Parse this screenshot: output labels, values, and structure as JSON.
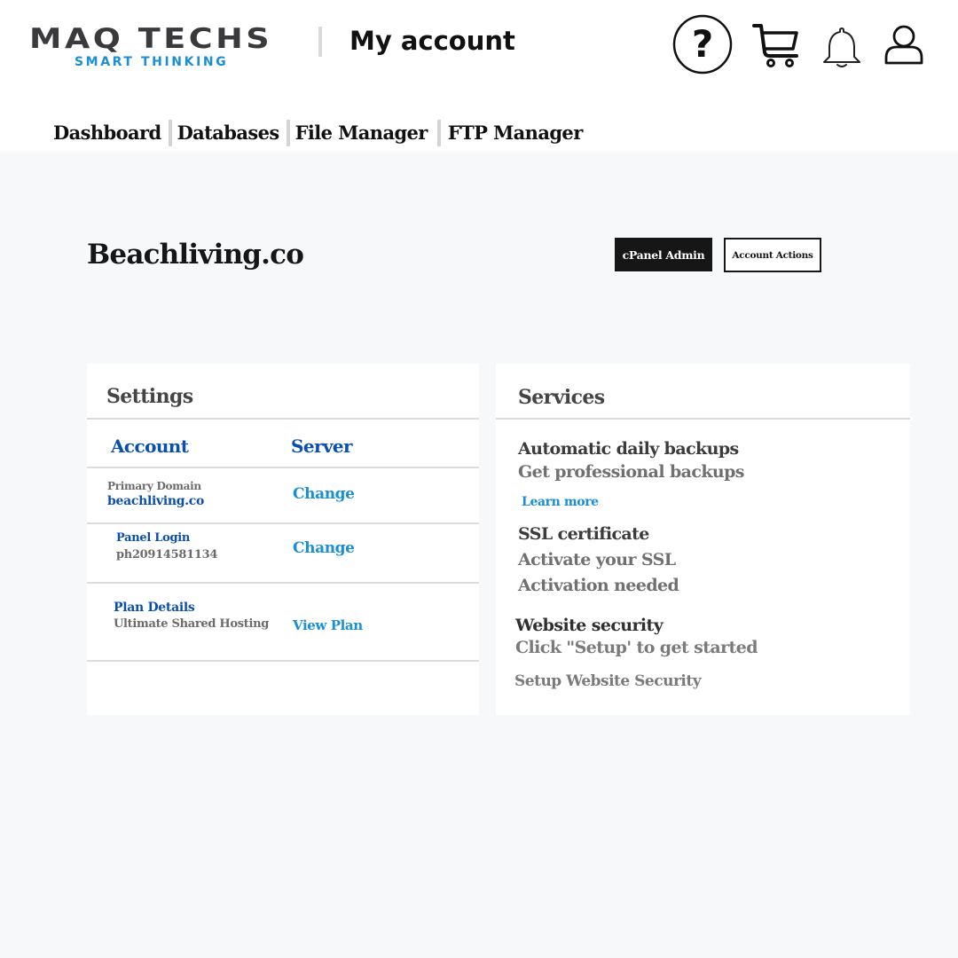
{
  "header": {
    "logo": {
      "name": "MAQ TECHS",
      "tagline": "SMART THINKING",
      "name_color": "#3a3a3c",
      "tagline_color": "#1a8fd6"
    },
    "page_title": "My account",
    "icons": [
      {
        "name": "help-icon",
        "label": "?"
      },
      {
        "name": "cart-icon"
      },
      {
        "name": "notifications-bell-icon"
      },
      {
        "name": "user-profile-icon"
      }
    ]
  },
  "nav": {
    "items": [
      {
        "label": "Dashboard"
      },
      {
        "label": "Databases"
      },
      {
        "label": "File Manager"
      },
      {
        "label": "FTP Manager"
      }
    ]
  },
  "account": {
    "domain_title": "Beachliving.co",
    "buttons": {
      "cpanel_admin": "cPanel Admin",
      "account_actions": "Account Actions"
    }
  },
  "settings": {
    "title": "Settings",
    "columns": {
      "account": "Account",
      "server": "Server"
    },
    "rows": [
      {
        "label": "Primary Domain",
        "value": "beachliving.co",
        "action": "Change"
      },
      {
        "label": "Panel Login",
        "value": "ph20914581134",
        "action": "Change"
      },
      {
        "label": "Plan Details",
        "value": "Ultimate Shared Hosting",
        "action": "View Plan"
      }
    ]
  },
  "services": {
    "title": "Services",
    "backups": {
      "heading": "Automatic daily backups",
      "subtitle": "Get professional backups",
      "link": "Learn more"
    },
    "ssl": {
      "heading": "SSL certificate",
      "subtitle": "Activate your SSL",
      "status": "Activation needed"
    },
    "security": {
      "heading": "Website security",
      "subtitle": "Click \"Setup' to get started",
      "link": "Setup Website Security"
    }
  },
  "colors": {
    "accent_blue": "#1a8fd6",
    "heading_blue": "#0b4fae",
    "page_bg": "#f7f8fa",
    "dark": "#161616"
  }
}
